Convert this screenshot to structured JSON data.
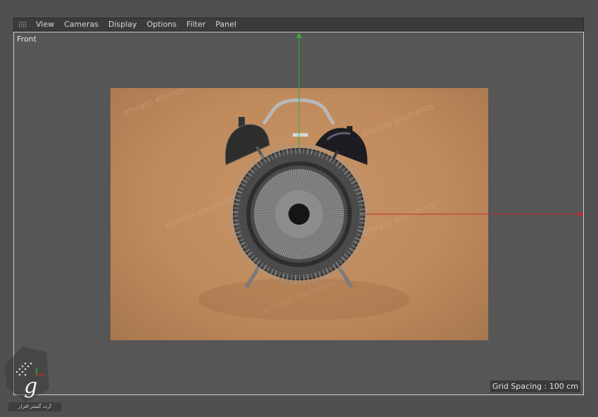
{
  "menu": {
    "items": [
      {
        "label": "View"
      },
      {
        "label": "Cameras"
      },
      {
        "label": "Display"
      },
      {
        "label": "Options"
      },
      {
        "label": "Filter"
      },
      {
        "label": "Panel"
      }
    ]
  },
  "viewport": {
    "label": "Front",
    "grid_spacing": "Grid Spacing : 100 cm",
    "axis_colors": {
      "y": "#2fae3a",
      "x": "#c22b2b"
    }
  },
  "background_image": {
    "watermark": "envato elements"
  },
  "logo": {
    "caption": "آرت گستر افزار"
  }
}
